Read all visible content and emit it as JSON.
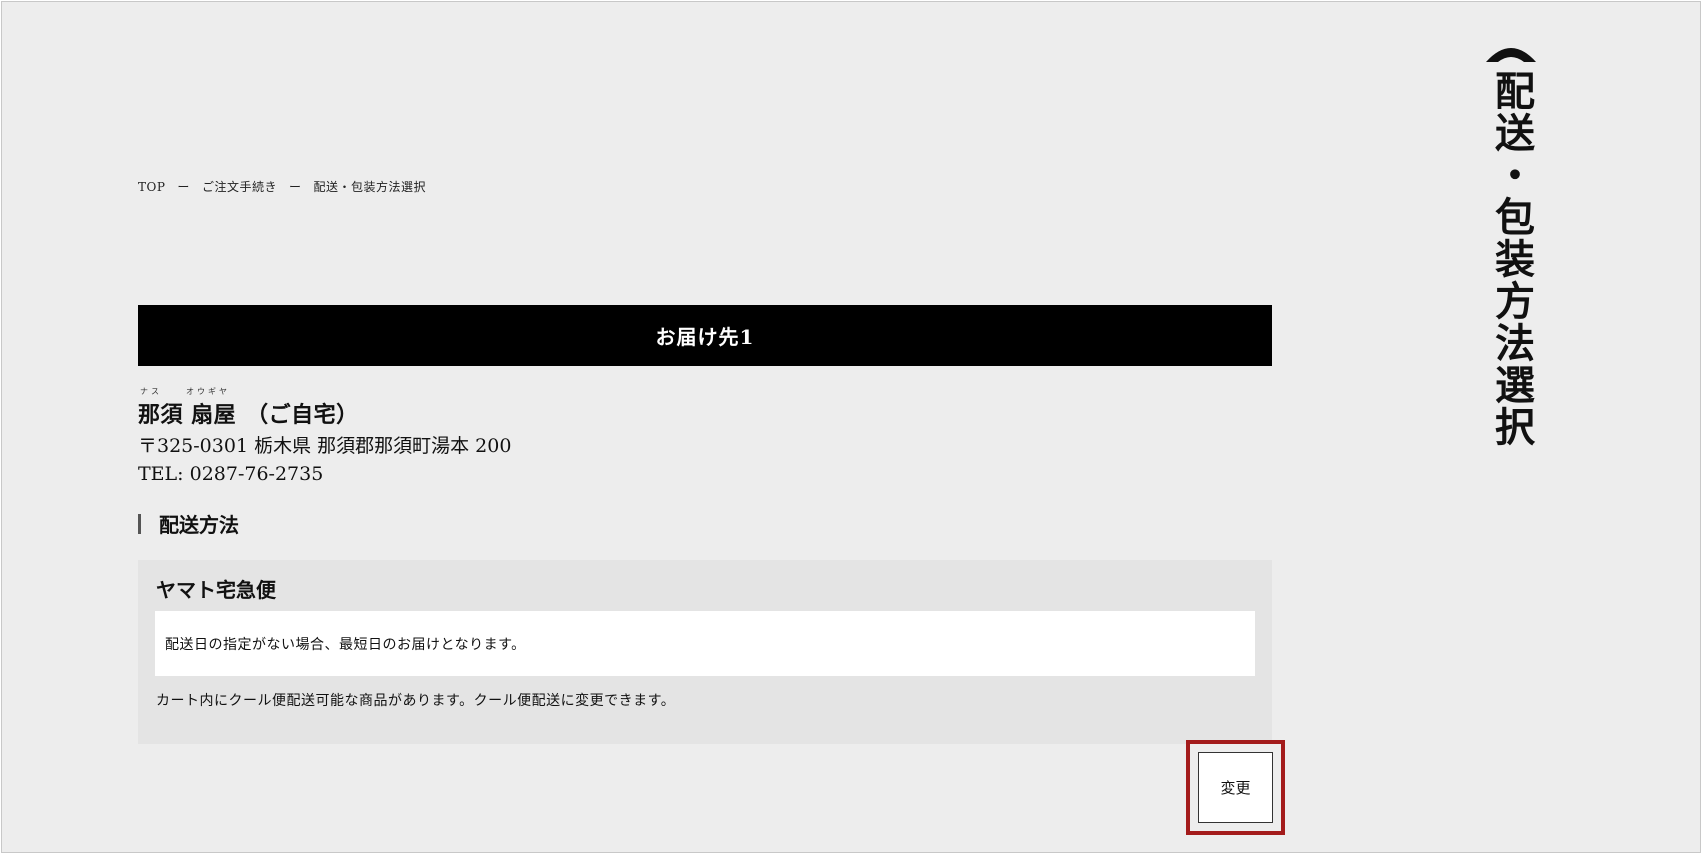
{
  "breadcrumb": {
    "items": [
      "TOP",
      "ご注文手続き",
      "配送・包装方法選択"
    ],
    "separator": "ー"
  },
  "destination": {
    "header": "お届け先1",
    "ruby_family": "ナス",
    "ruby_given": "オウギヤ",
    "name": "那須 扇屋",
    "label": "（ご自宅）",
    "address": "〒325-0301 栃木県 那須郡那須町湯本 200",
    "tel": "TEL: 0287-76-2735"
  },
  "shipping": {
    "section_title": "配送方法",
    "method_name": "ヤマト宅急便",
    "method_note": "配送日の指定がない場合、最短日のお届けとなります。",
    "cool_note": "カート内にクール便配送可能な商品があります。クール便配送に変更できます。",
    "change_label": "変更"
  },
  "side": {
    "title": "配送・包装方法選択",
    "icon": "fan-icon"
  },
  "colors": {
    "background": "#ededed",
    "header_bar": "#000000",
    "method_box": "#e4e4e4",
    "highlight": "#a31b1b"
  }
}
